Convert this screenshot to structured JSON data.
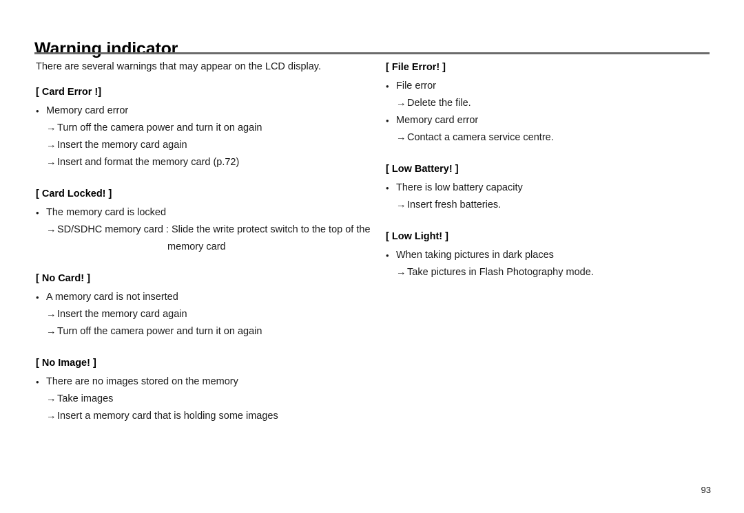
{
  "document": {
    "title": "Warning indicator",
    "intro": "There are several warnings that may appear on the LCD display.",
    "page_number": "93",
    "rule_color": "#6b6b6b",
    "bullet_glyph": "•",
    "arrow_glyph": "→"
  },
  "left_column": {
    "sections": [
      {
        "heading": "[ Card Error !]",
        "items": [
          {
            "type": "bullet",
            "text": "Memory card error"
          },
          {
            "type": "arrow",
            "text": "Turn off the camera power and turn it on again"
          },
          {
            "type": "arrow",
            "text": "Insert the memory card again"
          },
          {
            "type": "arrow",
            "text": "Insert and format the memory card (p.72)"
          }
        ]
      },
      {
        "heading": "[ Card Locked! ]",
        "items": [
          {
            "type": "bullet",
            "text": "The memory card is locked"
          },
          {
            "type": "arrow",
            "text": "SD/SDHC memory card : Slide the write protect switch to the top of the"
          },
          {
            "type": "cont",
            "text": "memory card"
          }
        ]
      },
      {
        "heading": "[ No Card! ]",
        "items": [
          {
            "type": "bullet",
            "text": "A memory card is not inserted"
          },
          {
            "type": "arrow",
            "text": "Insert the memory card again"
          },
          {
            "type": "arrow",
            "text": "Turn off the camera power and turn it on again"
          }
        ]
      },
      {
        "heading": "[ No Image! ]",
        "items": [
          {
            "type": "bullet",
            "text": "There are no images stored on the memory"
          },
          {
            "type": "arrow",
            "text": "Take images"
          },
          {
            "type": "arrow",
            "text": "Insert a memory card that is holding some images"
          }
        ]
      }
    ]
  },
  "right_column": {
    "sections": [
      {
        "heading": "[ File Error! ]",
        "items": [
          {
            "type": "bullet",
            "text": "File error"
          },
          {
            "type": "arrow",
            "text": "Delete the file."
          },
          {
            "type": "bullet",
            "text": "Memory card error"
          },
          {
            "type": "arrow",
            "text": "Contact a camera service centre."
          }
        ]
      },
      {
        "heading": "[ Low Battery! ]",
        "items": [
          {
            "type": "bullet",
            "text": "There is low battery capacity"
          },
          {
            "type": "arrow",
            "text": "Insert fresh batteries."
          }
        ]
      },
      {
        "heading": "[ Low Light! ]",
        "items": [
          {
            "type": "bullet",
            "text": "When taking pictures in dark places"
          },
          {
            "type": "arrow",
            "text": "Take pictures in Flash Photography mode."
          }
        ]
      }
    ]
  }
}
